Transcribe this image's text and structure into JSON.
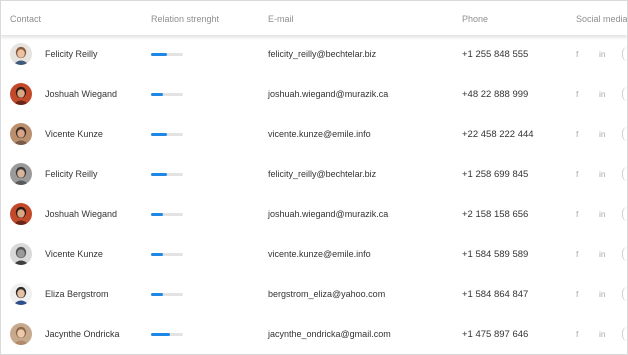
{
  "table": {
    "headers": {
      "contact": "Contact",
      "relation": "Relation strenght",
      "email": "E-mail",
      "phone": "Phone",
      "social": "Social media"
    },
    "rows": [
      {
        "name": "Felicity Reilly",
        "relation": 0.5,
        "email": "felicity_reilly@bechtelar.biz",
        "phone": "+1 255 848 555",
        "facebook": "f",
        "linkedin": "in",
        "avatar": {
          "bg": "#e7e3df",
          "hair": "#8a5a3a",
          "skin": "#e8c3a4",
          "shirt": "#3f5a7a"
        }
      },
      {
        "name": "Joshuah Wiegand",
        "relation": 0.38,
        "email": "joshuah.wiegand@murazik.ca",
        "phone": "+48 22 888 999",
        "facebook": "f",
        "linkedin": "in",
        "avatar": {
          "bg": "#c24a2a",
          "hair": "#2a1a12",
          "skin": "#d9a585",
          "shirt": "#6b2415"
        }
      },
      {
        "name": "Vicente Kunze",
        "relation": 0.5,
        "email": "vicente.kunze@emile.info",
        "phone": "+22 458 222 444",
        "facebook": "f",
        "linkedin": "in",
        "avatar": {
          "bg": "#b98f6e",
          "hair": "#3b2a22",
          "skin": "#d6a486",
          "shirt": "#7a5a48"
        }
      },
      {
        "name": "Felicity Reilly",
        "relation": 0.5,
        "email": "felicity_reilly@bechtelar.biz",
        "phone": "+1 258 699 845",
        "facebook": "f",
        "linkedin": "in",
        "avatar": {
          "bg": "#9a9a9a",
          "hair": "#3a3a3a",
          "skin": "#d8b49a",
          "shirt": "#595959"
        }
      },
      {
        "name": "Joshuah Wiegand",
        "relation": 0.38,
        "email": "joshuah.wiegand@murazik.ca",
        "phone": "+2 158 158 656",
        "facebook": "f",
        "linkedin": "in",
        "avatar": {
          "bg": "#c24a2a",
          "hair": "#2a1a12",
          "skin": "#d9a585",
          "shirt": "#6b2415"
        }
      },
      {
        "name": "Vicente Kunze",
        "relation": 0.38,
        "email": "vicente.kunze@emile.info",
        "phone": "+1 584 589 589",
        "facebook": "f",
        "linkedin": "in",
        "avatar": {
          "bg": "#d9d9d9",
          "hair": "#555555",
          "skin": "#9a9a9a",
          "shirt": "#3e3e3e"
        }
      },
      {
        "name": "Eliza Bergstrom",
        "relation": 0.38,
        "email": "bergstrom_eliza@yahoo.com",
        "phone": "+1 584 864 847",
        "facebook": "f",
        "linkedin": "in",
        "avatar": {
          "bg": "#f0f0f0",
          "hair": "#2d2d2d",
          "skin": "#e6c0a4",
          "shirt": "#2f4f8a"
        }
      },
      {
        "name": "Jacynthe Ondricka",
        "relation": 0.6,
        "email": "jacynthe_ondricka@gmail.com",
        "phone": "+1 475 897 646",
        "facebook": "f",
        "linkedin": "in",
        "avatar": {
          "bg": "#c7a98e",
          "hair": "#8a6a4a",
          "skin": "#edc9ac",
          "shirt": "#b08a6a"
        }
      }
    ]
  },
  "colors": {
    "accent": "#1e88e5",
    "track": "#e3e3e3",
    "header_text": "#8f8f8f",
    "social_icon": "#a9a9a9"
  },
  "icons": {
    "facebook": "facebook-icon",
    "linkedin": "linkedin-icon"
  }
}
